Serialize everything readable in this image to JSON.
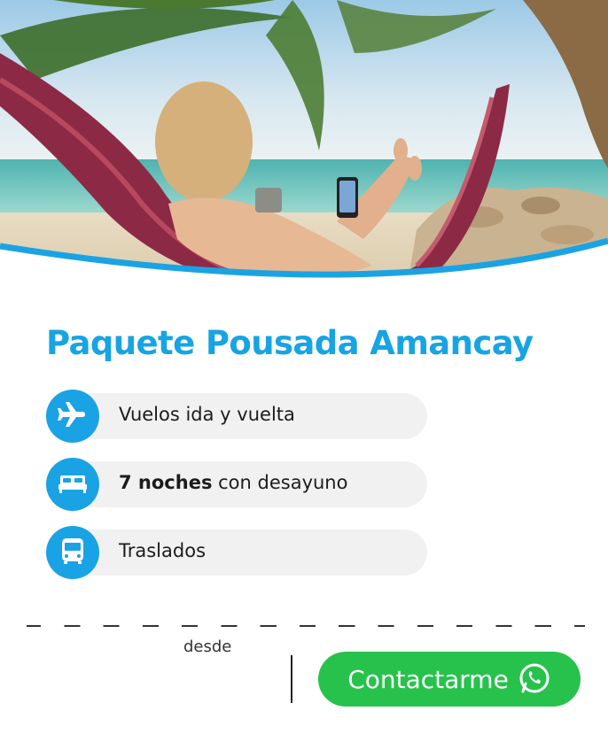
{
  "package": {
    "title": "Paquete Pousada Amancay"
  },
  "features": [
    {
      "icon": "airplane-icon",
      "bold": "",
      "text": "Vuelos ida y vuelta"
    },
    {
      "icon": "bed-icon",
      "bold": "7 noches",
      "text": " con desayuno"
    },
    {
      "icon": "bus-icon",
      "bold": "",
      "text": "Traslados"
    }
  ],
  "price": {
    "prefix": "desde"
  },
  "cta": {
    "label": "Contactarme",
    "icon": "whatsapp-icon"
  },
  "colors": {
    "brand": "#1aa3e4",
    "title": "#17a4e3",
    "pill": "#f1f1f1",
    "cta": "#27c24c"
  }
}
